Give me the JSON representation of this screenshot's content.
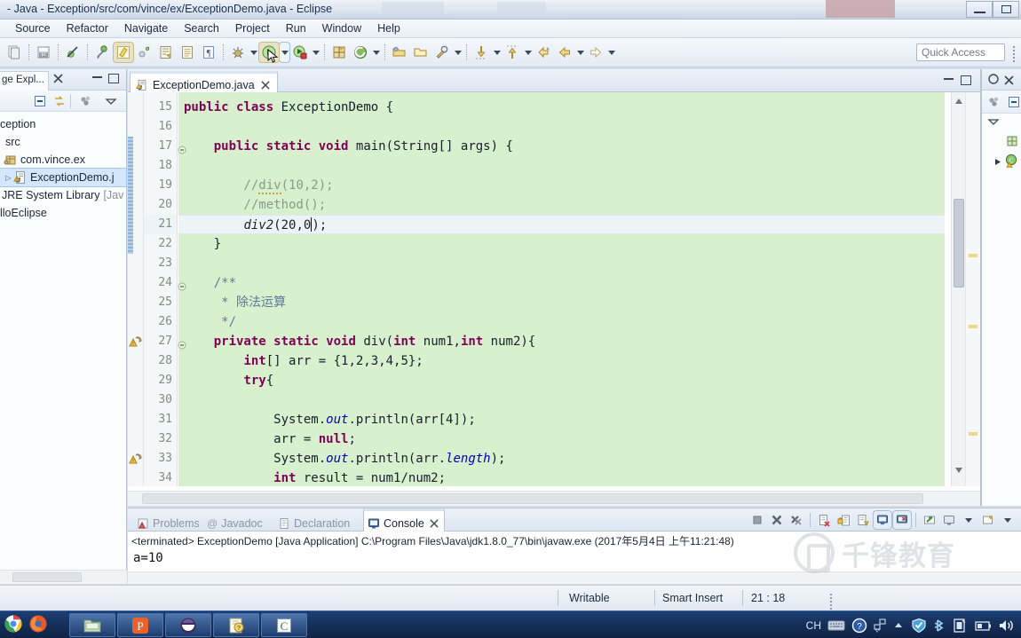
{
  "window": {
    "title": "- Java - Exception/src/com/vince/ex/ExceptionDemo.java - Eclipse",
    "minimize_label": "minimize",
    "maximize_label": "maximize"
  },
  "menubar": {
    "items": [
      {
        "label": "Source"
      },
      {
        "label": "Refactor"
      },
      {
        "label": "Navigate"
      },
      {
        "label": "Search"
      },
      {
        "label": "Project"
      },
      {
        "label": "Run"
      },
      {
        "label": "Window"
      },
      {
        "label": "Help"
      }
    ]
  },
  "toolbar": {
    "quick_access_placeholder": "Quick Access",
    "icons": [
      "new-wizard-icon",
      "save-icon",
      "build-all-icon",
      "skip-breakpoints-icon",
      "debug-last-icon",
      "run-last-icon",
      "external-tools-icon",
      "new-java-project-icon",
      "new-package-icon",
      "new-class-icon",
      "search-icon",
      "open-type-icon",
      "next-annotation-icon",
      "previous-annotation-icon",
      "back-icon",
      "forward-icon"
    ]
  },
  "package_explorer": {
    "tab_label": "ge Expl...",
    "close_label": "✕",
    "toolbar_icons": [
      "collapse-all-icon",
      "link-with-editor-icon",
      "view-menu-icon",
      "focus-icon"
    ],
    "tree": [
      {
        "label": "ception",
        "icon": "java-project-icon",
        "indent": 0,
        "arrow": ""
      },
      {
        "label": "src",
        "icon": "source-folder-icon",
        "indent": 1,
        "arrow": ""
      },
      {
        "label": "com.vince.ex",
        "icon": "package-icon",
        "indent": 1,
        "arrow": ""
      },
      {
        "label": "ExceptionDemo.j",
        "icon": "java-file-warning-icon",
        "indent": 2,
        "arrow": "▷",
        "selected": true
      },
      {
        "label": "JRE System Library",
        "suffix": "[Jav",
        "icon": "library-icon",
        "indent": 1,
        "arrow": ""
      },
      {
        "label": "lloEclipse",
        "icon": "java-project-icon",
        "indent": 0,
        "arrow": ""
      }
    ]
  },
  "editor": {
    "tab": {
      "label": "ExceptionDemo.java",
      "icon": "java-file-warning-icon",
      "close_label": "✕"
    },
    "first_line": 15,
    "lines": [
      {
        "n": 15,
        "fold": "",
        "marker": "",
        "current": false,
        "tokens": [
          {
            "t": "public",
            "c": "kw"
          },
          {
            "t": " ",
            "c": ""
          },
          {
            "t": "class",
            "c": "kw"
          },
          {
            "t": " ExceptionDemo {",
            "c": ""
          }
        ]
      },
      {
        "n": 16,
        "fold": "",
        "marker": "",
        "current": false,
        "tokens": []
      },
      {
        "n": 17,
        "fold": "-",
        "marker": "",
        "current": false,
        "tokens": [
          {
            "t": "    ",
            "c": ""
          },
          {
            "t": "public",
            "c": "kw"
          },
          {
            "t": " ",
            "c": ""
          },
          {
            "t": "static",
            "c": "kw"
          },
          {
            "t": " ",
            "c": ""
          },
          {
            "t": "void",
            "c": "kw"
          },
          {
            "t": " main(String[] args) {",
            "c": ""
          }
        ]
      },
      {
        "n": 18,
        "fold": "",
        "marker": "",
        "current": false,
        "tokens": []
      },
      {
        "n": 19,
        "fold": "",
        "marker": "",
        "current": false,
        "tokens": [
          {
            "t": "        //",
            "c": "cmt"
          },
          {
            "t": "div",
            "c": "cmt squig"
          },
          {
            "t": "(10,2);",
            "c": "cmt"
          }
        ]
      },
      {
        "n": 20,
        "fold": "",
        "marker": "",
        "current": false,
        "tokens": [
          {
            "t": "        //method();",
            "c": "cmt"
          }
        ]
      },
      {
        "n": 21,
        "fold": "",
        "marker": "",
        "current": true,
        "tokens": [
          {
            "t": "        ",
            "c": ""
          },
          {
            "t": "div2",
            "c": "mth"
          },
          {
            "t": "(20,0",
            "c": ""
          },
          {
            "t": "|",
            "c": "caret"
          },
          {
            "t": ");",
            "c": ""
          }
        ]
      },
      {
        "n": 22,
        "fold": "",
        "marker": "",
        "current": false,
        "tokens": [
          {
            "t": "    }",
            "c": ""
          }
        ]
      },
      {
        "n": 23,
        "fold": "",
        "marker": "",
        "current": false,
        "tokens": []
      },
      {
        "n": 24,
        "fold": "-",
        "marker": "",
        "current": false,
        "tokens": [
          {
            "t": "    /**",
            "c": "cmt-doc"
          }
        ]
      },
      {
        "n": 25,
        "fold": "",
        "marker": "",
        "current": false,
        "tokens": [
          {
            "t": "     * 除法运算",
            "c": "cmt-doc"
          }
        ]
      },
      {
        "n": 26,
        "fold": "",
        "marker": "",
        "current": false,
        "tokens": [
          {
            "t": "     */",
            "c": "cmt-doc"
          }
        ]
      },
      {
        "n": 27,
        "fold": "-",
        "marker": "warning",
        "current": false,
        "tokens": [
          {
            "t": "    ",
            "c": ""
          },
          {
            "t": "private",
            "c": "kw"
          },
          {
            "t": " ",
            "c": ""
          },
          {
            "t": "static",
            "c": "kw"
          },
          {
            "t": " ",
            "c": ""
          },
          {
            "t": "void",
            "c": "kw"
          },
          {
            "t": " div(",
            "c": ""
          },
          {
            "t": "int",
            "c": "kw"
          },
          {
            "t": " num1,",
            "c": ""
          },
          {
            "t": "int",
            "c": "kw"
          },
          {
            "t": " num2){",
            "c": ""
          }
        ]
      },
      {
        "n": 28,
        "fold": "",
        "marker": "",
        "current": false,
        "tokens": [
          {
            "t": "        ",
            "c": ""
          },
          {
            "t": "int",
            "c": "kw"
          },
          {
            "t": "[] arr = {1,2,3,4,5};",
            "c": ""
          }
        ]
      },
      {
        "n": 29,
        "fold": "",
        "marker": "",
        "current": false,
        "tokens": [
          {
            "t": "        ",
            "c": ""
          },
          {
            "t": "try",
            "c": "kw"
          },
          {
            "t": "{",
            "c": ""
          }
        ]
      },
      {
        "n": 30,
        "fold": "",
        "marker": "",
        "current": false,
        "tokens": []
      },
      {
        "n": 31,
        "fold": "",
        "marker": "",
        "current": false,
        "tokens": [
          {
            "t": "            System.",
            "c": ""
          },
          {
            "t": "out",
            "c": "fld"
          },
          {
            "t": ".println(arr[4]);",
            "c": ""
          }
        ]
      },
      {
        "n": 32,
        "fold": "",
        "marker": "",
        "current": false,
        "tokens": [
          {
            "t": "            arr = ",
            "c": ""
          },
          {
            "t": "null",
            "c": "kw"
          },
          {
            "t": ";",
            "c": ""
          }
        ]
      },
      {
        "n": 33,
        "fold": "",
        "marker": "warning",
        "current": false,
        "tokens": [
          {
            "t": "            System.",
            "c": ""
          },
          {
            "t": "out",
            "c": "fld"
          },
          {
            "t": ".println(arr.",
            "c": ""
          },
          {
            "t": "length",
            "c": "fld"
          },
          {
            "t": ");",
            "c": ""
          }
        ]
      },
      {
        "n": 34,
        "fold": "",
        "marker": "",
        "current": false,
        "tokens": [
          {
            "t": "            ",
            "c": ""
          },
          {
            "t": "int",
            "c": "kw"
          },
          {
            "t": " result = num1/num2;",
            "c": ""
          }
        ]
      }
    ]
  },
  "outline": {
    "tab_icon": "outline-icon",
    "close_label": "✕",
    "toolbar_icons": [
      "focus-icon",
      "collapse-all-icon",
      "view-menu-icon"
    ],
    "rows": [
      "package-icon",
      "class-warning-icon"
    ]
  },
  "console": {
    "tabs": [
      {
        "label": "Problems",
        "icon": "problems-icon",
        "active": false
      },
      {
        "label": "Javadoc",
        "icon": "javadoc-icon",
        "active": false
      },
      {
        "label": "Declaration",
        "icon": "declaration-icon",
        "active": false
      },
      {
        "label": "Console",
        "icon": "console-icon",
        "active": true,
        "close_label": "✕"
      }
    ],
    "terminated_line": "<terminated> ExceptionDemo [Java Application] C:\\Program Files\\Java\\jdk1.8.0_77\\bin\\javaw.exe (2017年5月4日 上午11:21:48)",
    "output": "a=10",
    "toolbar_icons": [
      "terminate-icon",
      "remove-launch-icon",
      "remove-all-launches-icon",
      "clear-console-icon",
      "scroll-lock-icon",
      "pin-console-icon",
      "display-selected-console-icon",
      "open-console-icon",
      "new-console-view-icon",
      "console-menu-icon",
      "new-console-icon"
    ]
  },
  "statusbar": {
    "writable": "Writable",
    "insert_mode": "Smart Insert",
    "position": "21 : 18"
  },
  "taskbar": {
    "apps": [
      "chrome-icon",
      "firefox-icon",
      "file-explorer-icon",
      "powerpoint-icon",
      "eclipse-icon",
      "help-icon",
      "app-icon"
    ],
    "tray": {
      "input_method": "CH",
      "icons": [
        "keyboard-icon",
        "help-icon",
        "network-icon",
        "show-hidden-icon",
        "shield-icon",
        "bluetooth-icon",
        "safe-remove-icon",
        "battery-icon",
        "volume-icon"
      ]
    }
  },
  "watermark": {
    "text": "千锋教育"
  },
  "colors": {
    "editor_background": "#d8f0cd",
    "keyword": "#7f0055",
    "comment": "#8a9a88",
    "javadoc": "#5a7a9a",
    "field": "#0000c0",
    "current_line": "#eef3f8",
    "taskbar": "#17325e",
    "titlebar": "#dde5f0"
  }
}
